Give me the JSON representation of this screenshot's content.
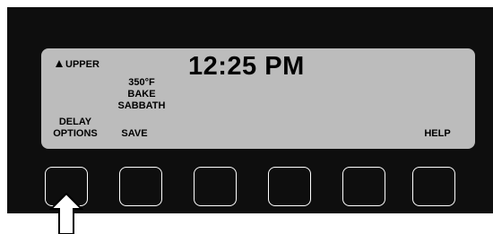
{
  "display": {
    "oven_indicator": "UPPER",
    "time": "12:25 PM",
    "temperature": "350°F",
    "mode": "BAKE",
    "sabbath": "SABBATH"
  },
  "softkeys": {
    "key1_label_line1": "DELAY",
    "key1_label_line2": "OPTIONS",
    "key2_label": "SAVE",
    "key6_label": "HELP"
  }
}
